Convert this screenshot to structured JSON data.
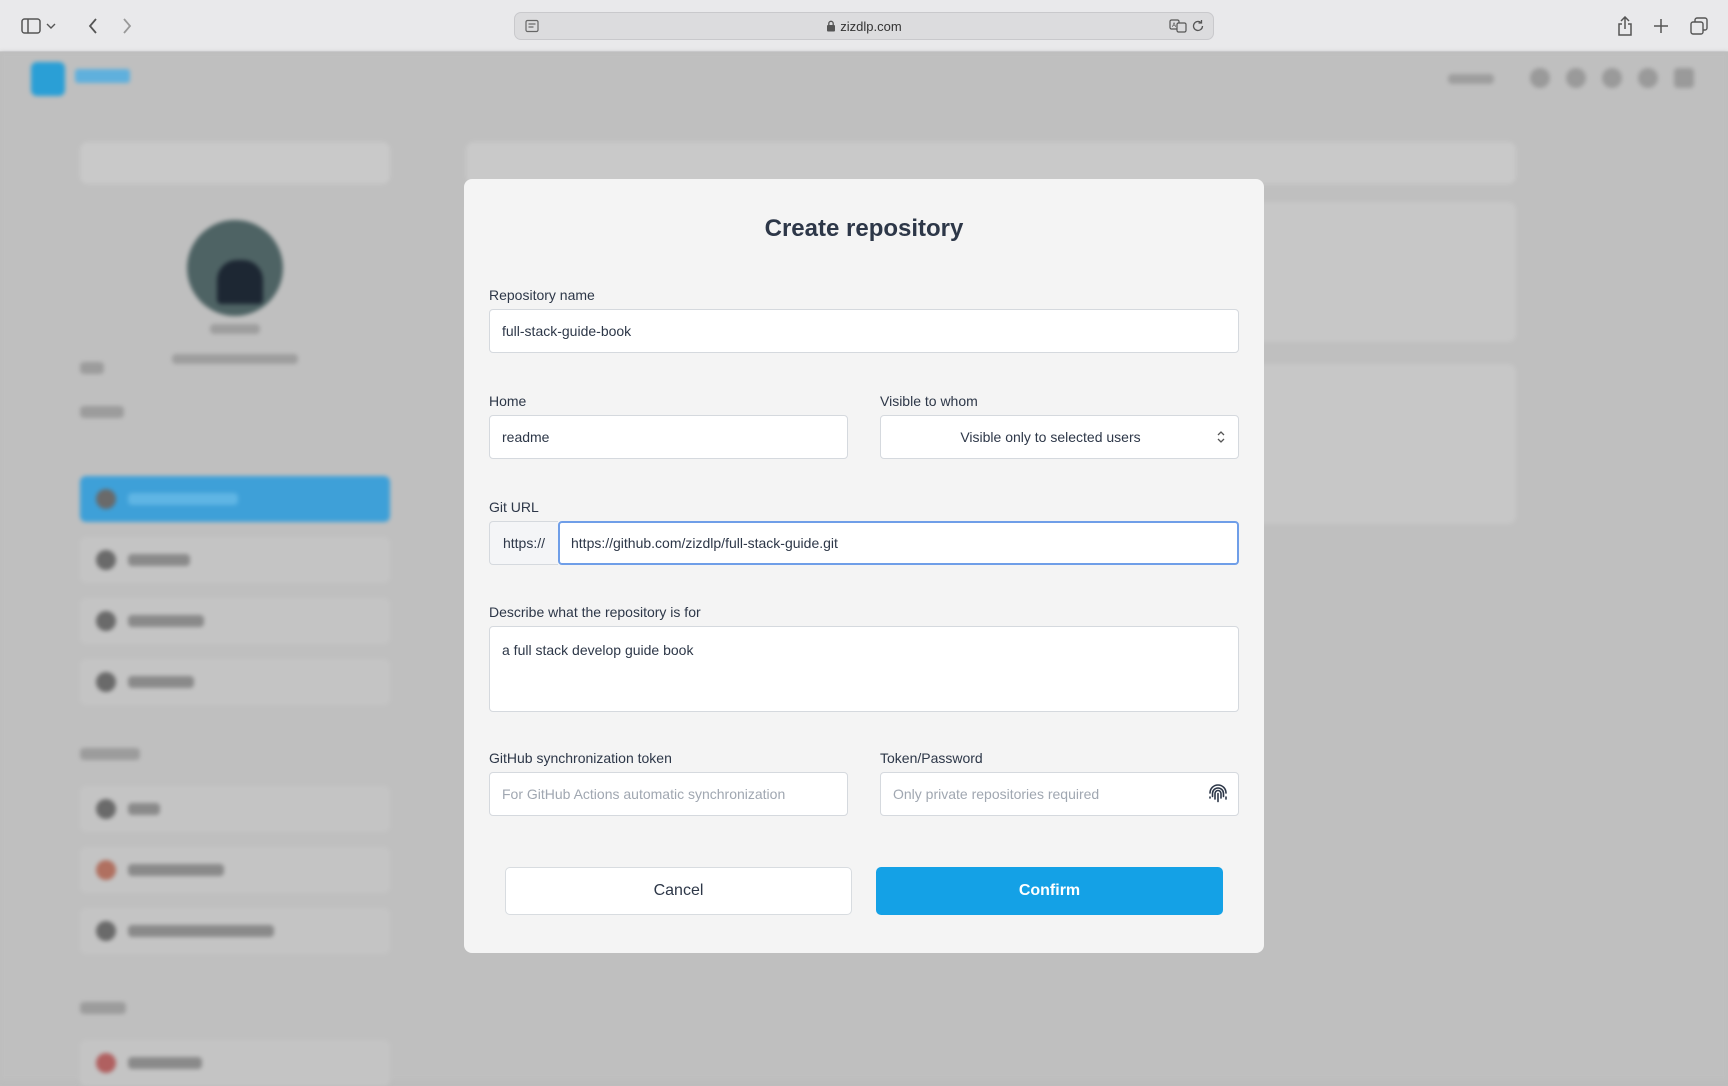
{
  "browser": {
    "url": "zizdlp.com",
    "icons": [
      "sidebar-icon",
      "chevron-down-icon",
      "back-icon",
      "forward-icon",
      "page-icon",
      "lock-icon",
      "translate-icon",
      "reload-icon",
      "share-icon",
      "new-tab-icon",
      "tabs-overview-icon"
    ]
  },
  "modal": {
    "title": "Create repository",
    "repo_name": {
      "label": "Repository name",
      "value": "full-stack-guide-book"
    },
    "home": {
      "label": "Home",
      "value": "readme"
    },
    "visibility": {
      "label": "Visible to whom",
      "selected": "Visible only to selected users"
    },
    "git_url": {
      "label": "Git URL",
      "prefix": "https://",
      "value": "https://github.com/zizdlp/full-stack-guide.git"
    },
    "description": {
      "label": "Describe what the repository is for",
      "value": "a full stack develop guide book"
    },
    "sync_token": {
      "label": "GitHub synchronization token",
      "placeholder": "For GitHub Actions automatic synchronization"
    },
    "token_password": {
      "label": "Token/Password",
      "placeholder": "Only private repositories required",
      "icon": "fingerprint-icon"
    },
    "cancel_label": "Cancel",
    "confirm_label": "Confirm"
  },
  "colors": {
    "accent": "#14a1e6",
    "focus_border": "#6f9ee8",
    "overlay": "#bdbdbd",
    "modal_bg": "#f4f4f4"
  }
}
